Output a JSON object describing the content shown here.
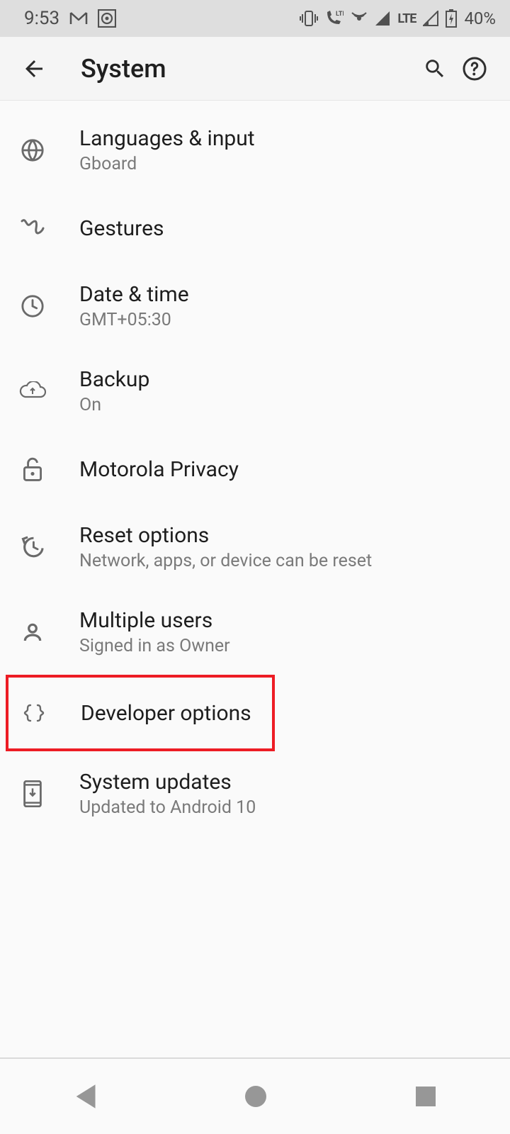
{
  "status": {
    "time": "9:53",
    "lte": "LTE",
    "battery_pct": "40%"
  },
  "header": {
    "title": "System"
  },
  "items": {
    "languages": {
      "title": "Languages & input",
      "subtitle": "Gboard"
    },
    "gestures": {
      "title": "Gestures"
    },
    "datetime": {
      "title": "Date & time",
      "subtitle": "GMT+05:30"
    },
    "backup": {
      "title": "Backup",
      "subtitle": "On"
    },
    "privacy": {
      "title": "Motorola Privacy"
    },
    "reset": {
      "title": "Reset options",
      "subtitle": "Network, apps, or device can be reset"
    },
    "users": {
      "title": "Multiple users",
      "subtitle": "Signed in as Owner"
    },
    "developer": {
      "title": "Developer options"
    },
    "updates": {
      "title": "System updates",
      "subtitle": "Updated to Android 10"
    }
  }
}
